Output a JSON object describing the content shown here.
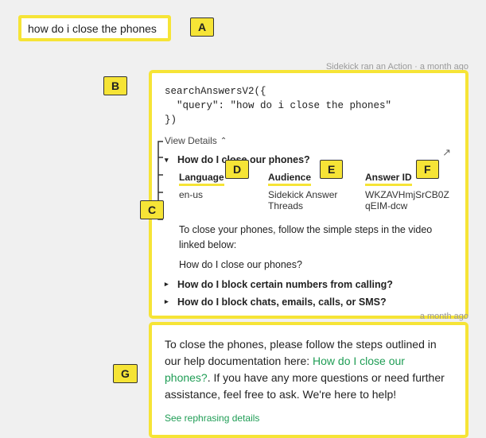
{
  "query_box": "how do i close the phones",
  "callouts": {
    "A": "A",
    "B": "B",
    "C": "C",
    "D": "D",
    "E": "E",
    "F": "F",
    "G": "G"
  },
  "timestamps": {
    "action": "Sidekick ran an Action · a month ago",
    "reply": "a month ago"
  },
  "search_call": {
    "fn": "searchAnswersV2({",
    "arg": "  \"query\": \"how do i close the phones\"",
    "close": "})"
  },
  "view_details": "View Details",
  "results": {
    "r0": {
      "title": "How do I close our phones?",
      "cols": {
        "lang_h": "Language",
        "lang_v": "en-us",
        "aud_h": "Audience",
        "aud_v": "Sidekick Answer Threads",
        "id_h": "Answer ID",
        "id_v": "WKZAVHmjSrCB0ZqEIM-dcw"
      },
      "body1": "To close your phones, follow the simple steps in the video linked below:",
      "body2": "How do I close our phones?"
    },
    "r1": {
      "title": "How do I block certain numbers from calling?"
    },
    "r2": {
      "title": "How do I block chats, emails, calls, or SMS?"
    }
  },
  "reply": {
    "pre": "To close the phones, please follow the steps outlined in our help documentation here: ",
    "link": "How do I close our phones?",
    "post": ". If you have any more questions or need further assistance, feel free to ask. We're here to help!",
    "rephrase": "See rephrasing details"
  }
}
